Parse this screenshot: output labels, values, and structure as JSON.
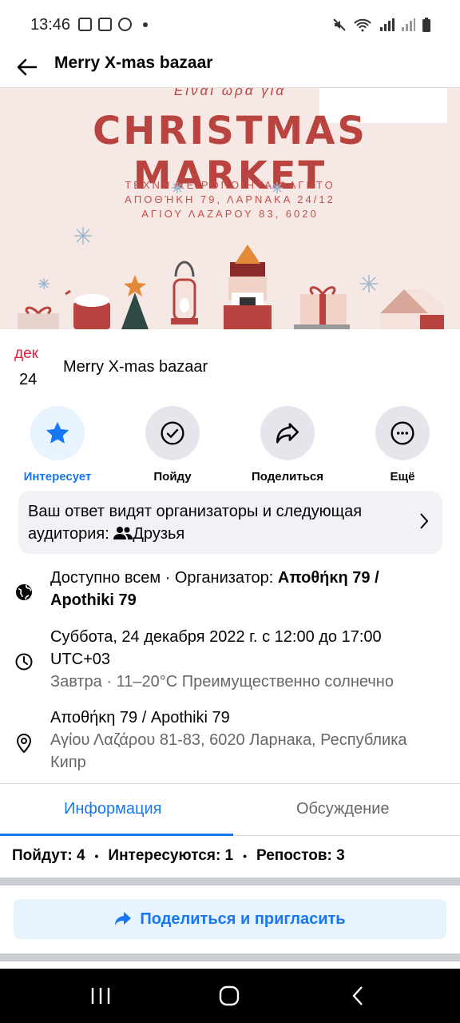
{
  "status": {
    "time": "13:46"
  },
  "appbar": {
    "title": "Merry X-mas bazaar"
  },
  "banner": {
    "subtitle": "Είναι ώρα για",
    "title": "CHRISTMAS MARKET",
    "line1": "ΤΕΧΝΗ   ΧΕΙΡΟΠΟΙΗΤΑ   ΦΑΓΗΤΟ",
    "line2": "ΑΠΟΘΉΚΗ 79, ΛΑΡΝΑΚΑ 24/12",
    "line3": "ΑΓΙΟΥ ΛΑΖΑΡΟΥ 83, 6020"
  },
  "event": {
    "month": "дек",
    "day": "24",
    "name": "Merry X-mas bazaar"
  },
  "actions": {
    "interested": "Интересует",
    "going": "Пойду",
    "share": "Поделиться",
    "more": "Ещё"
  },
  "audience": {
    "text": "Ваш ответ видят организаторы и следующая аудитория:",
    "group": "Друзья"
  },
  "details": {
    "privacy": "Доступно всем · Организатор: ",
    "organizer": "Αποθήκη 79 / Apothiki 79",
    "datetime": "Суббота, 24 декабря 2022 г. с 12:00 до 17:00 UTC+03",
    "weather": "Завтра · 11–20°C Преимущественно солнечно",
    "venue": "Αποθήκη 79 / Apothiki 79",
    "address": "Αγίου Λαζάρου 81-83, 6020 Ларнака, Республика Кипр"
  },
  "tabs": {
    "info": "Информация",
    "discussion": "Обсуждение"
  },
  "stats": {
    "going": "Пойдут: 4",
    "interested": "Интересуются: 1",
    "reposts": "Репостов: 3"
  },
  "share_invite": "Поделиться и пригласить",
  "colors": {
    "accent": "#1877f2",
    "date": "#e41e3f",
    "banner_red": "#b9433f"
  }
}
